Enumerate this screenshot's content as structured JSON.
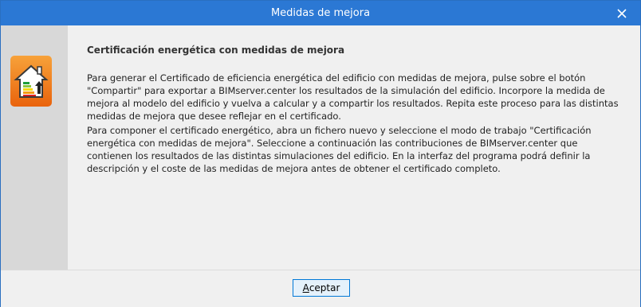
{
  "window": {
    "title": "Medidas de mejora",
    "accent_color": "#2b78d4"
  },
  "icons": {
    "close": "close-icon",
    "app": "energy-certificate-house-icon"
  },
  "content": {
    "heading": "Certificación energética con medidas de mejora",
    "paragraph_1": "Para generar el Certificado de eficiencia energética del edificio con medidas de mejora, pulse sobre el botón \"Compartir\" para exportar a BIMserver.center los resultados de la simulación del edificio. Incorpore la medida de mejora al modelo del edificio y vuelva a calcular y a compartir los resultados. Repita este proceso para las distintas medidas de mejora que desee reflejar en el certificado.",
    "paragraph_2": "Para componer el certificado energético, abra un fichero nuevo y seleccione el modo de trabajo \"Certificación energética con medidas de mejora\". Seleccione a continuación las contribuciones de BIMserver.center que contienen los resultados de las distintas simulaciones del edificio. En la interfaz del programa podrá definir la descripción y el coste de las medidas de mejora antes de obtener el certificado completo."
  },
  "footer": {
    "accept_mnemonic": "A",
    "accept_rest": "ceptar"
  }
}
